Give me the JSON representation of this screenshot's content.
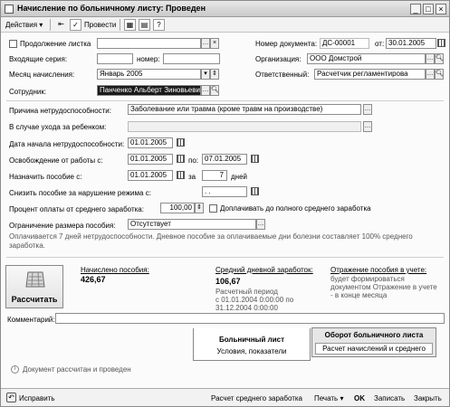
{
  "window": {
    "title": "Начисление по больничному листу: Проведен"
  },
  "toolbar": {
    "actions": "Действия",
    "post": "Провести"
  },
  "left": {
    "continuation": "Продолжение листка",
    "series_label": "Входящие серия:",
    "number_label": "номер:",
    "month_label": "Месяц начисления:",
    "month_value": "Январь 2005",
    "employee_label": "Сотрудник:",
    "employee_value": "Панченко Альберт Зиновьевич"
  },
  "right": {
    "doc_number_label": "Номер документа:",
    "doc_number_value": "ДС-00001",
    "from_label": "от:",
    "from_value": "30.01.2005",
    "org_label": "Организация:",
    "org_value": "ООО Домстрой",
    "resp_label": "Ответственный:",
    "resp_value": "Расчетчик регламентирова"
  },
  "details": {
    "reason_label": "Причина нетрудоспособности:",
    "reason_value": "Заболевание или травма (кроме травм на производстве)",
    "child_label": "В случае ухода за ребенком:",
    "start_label": "Дата начала нетрудоспособности:",
    "start_value": "01.01.2005",
    "release_label": "Освобождение от работы с:",
    "release_from": "01.01.2005",
    "release_to_label": "по:",
    "release_to": "07.01.2005",
    "assign_label": "Назначить пособие с:",
    "assign_from": "01.01.2005",
    "assign_for_label": "за",
    "assign_days": "7",
    "days_label": "дней",
    "reduce_label": "Снизить пособие за нарушение режима с:",
    "reduce_value": ". .",
    "percent_label": "Процент оплаты от среднего заработка:",
    "percent_value": "100,00",
    "topup_label": "Доплачивать до полного среднего заработка",
    "limit_label": "Ограничение размера пособия:",
    "limit_value": "Отсутствует",
    "note": "Оплачивается 7 дней нетрудоспособности. Дневное пособие за оплачиваемые дни болезни составляет 100% среднего заработка."
  },
  "results": {
    "calc_button": "Рассчитать",
    "accrued_label": "Начислено пособия:",
    "accrued_value": "426,67",
    "avg_label": "Средний дневной заработок:",
    "avg_value": "106,67",
    "period_1": "Расчетный период",
    "period_2": "с 01.01.2004 0:00:00 по",
    "period_3": "31.12.2004 0:00:00",
    "reflect_label": "Отражение пособия в учете:",
    "reflect_1": "будет формироваться",
    "reflect_2": "документом Отражение в учете",
    "reflect_3": "- в конце месяца"
  },
  "comment_label": "Комментарий:",
  "tabs": [
    {
      "title": "Больничный лист",
      "sub": "Условия, показатели"
    },
    {
      "title": "Оборот больничного листа",
      "sub": "Расчет начислений и среднего"
    }
  ],
  "status": "Документ рассчитан и проведен",
  "bottom": {
    "fix": "Исправить",
    "avg_calc": "Расчет среднего заработка",
    "print": "Печать",
    "ok": "OK",
    "write": "Записать",
    "close": "Закрыть"
  }
}
